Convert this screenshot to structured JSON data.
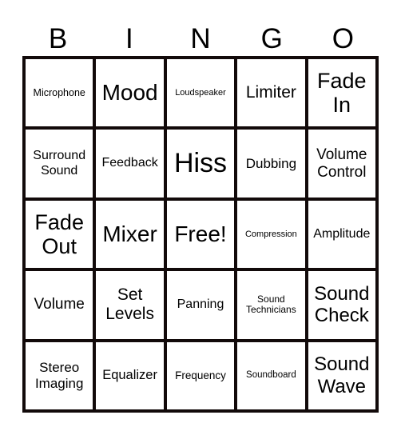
{
  "title_letters": [
    "B",
    "I",
    "N",
    "G",
    "O"
  ],
  "cells": [
    [
      "Microphone",
      "Mood",
      "Loudspeaker",
      "Limiter",
      "Fade In"
    ],
    [
      "Surround Sound",
      "Feedback",
      "Hiss",
      "Dubbing",
      "Volume Control"
    ],
    [
      "Fade Out",
      "Mixer",
      "Free!",
      "Compression",
      "Amplitude"
    ],
    [
      "Volume",
      "Set Levels",
      "Panning",
      "Sound Technicians",
      "Sound Check"
    ],
    [
      "Stereo Imaging",
      "Equalizer",
      "Frequency",
      "Soundboard",
      "Sound Wave"
    ]
  ],
  "colors": {
    "grid_line": "#120a0a",
    "background": "#ffffff",
    "text": "#000000"
  }
}
